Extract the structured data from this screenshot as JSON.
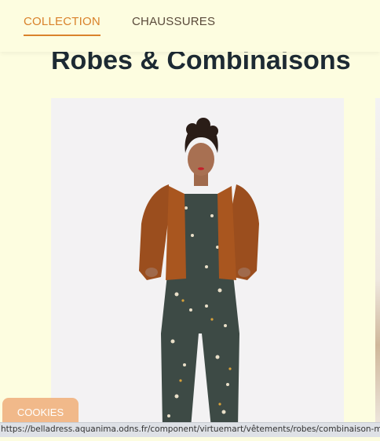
{
  "nav": {
    "items": [
      {
        "label": "COLLECTION",
        "active": true
      },
      {
        "label": "CHAUSSURES",
        "active": false
      }
    ],
    "accent_color": "#d9822b"
  },
  "page": {
    "title": "Robes & Combinaisons"
  },
  "product": {
    "image_alt": "model-wearing-floral-jumpsuit-and-rust-cardigan"
  },
  "cookies": {
    "label": "COOKIES",
    "color": "#f1b98a"
  },
  "status_bar": {
    "url": "https://belladress.aquanima.odns.fr/component/virtuemart/vêtements/robes/combinaison-m"
  }
}
